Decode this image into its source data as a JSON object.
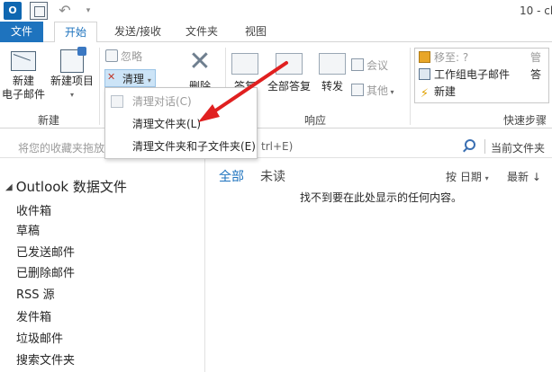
{
  "window": {
    "title": "10 - ch",
    "app_icon_label": "O"
  },
  "tabs": [
    {
      "label": "文件"
    },
    {
      "label": "开始"
    },
    {
      "label": "发送/接收"
    },
    {
      "label": "文件夹"
    },
    {
      "label": "视图"
    }
  ],
  "ribbon": {
    "new_group": {
      "new_email": "新建\n电子邮件",
      "new_items": "新建项目",
      "label": "新建"
    },
    "delete_group": {
      "ignore": "忽略",
      "cleanup": "清理",
      "junk": "",
      "delete": "删除"
    },
    "respond_group": {
      "reply": "答复",
      "reply_all": "全部答复",
      "forward": "转发",
      "meeting": "会议",
      "more": "其他",
      "label": "响应"
    },
    "quick_steps": {
      "move_to": "移至: ?",
      "team_email": "工作组电子邮件",
      "new": "新建",
      "right_col_1": "管",
      "right_col_2": "答",
      "label": "快速步骤"
    }
  },
  "cleanup_menu": {
    "items": [
      {
        "label": "清理对话(C)",
        "disabled": true
      },
      {
        "label": "清理文件夹(L)",
        "disabled": false
      },
      {
        "label": "清理文件夹和子文件夹(E)",
        "disabled": false
      }
    ]
  },
  "search": {
    "favorites_hint": "将您的收藏夹拖放",
    "field_value": "trl+E)",
    "scope": "当前文件夹"
  },
  "folder_pane": {
    "data_file": "Outlook 数据文件",
    "folders": [
      "收件箱",
      "草稿",
      "已发送邮件",
      "已删除邮件",
      "RSS 源",
      "发件箱",
      "垃圾邮件",
      "搜索文件夹"
    ]
  },
  "message_list": {
    "filter_all": "全部",
    "filter_unread": "未读",
    "sort_by": "按 日期",
    "sort_order": "最新",
    "empty_text": "找不到要在此处显示的任何内容。"
  },
  "watermark": "Bai经验",
  "colors": {
    "accent": "#1e73be",
    "annotation_arrow": "#e02020",
    "cleanup_highlight": "#cce4f7"
  }
}
